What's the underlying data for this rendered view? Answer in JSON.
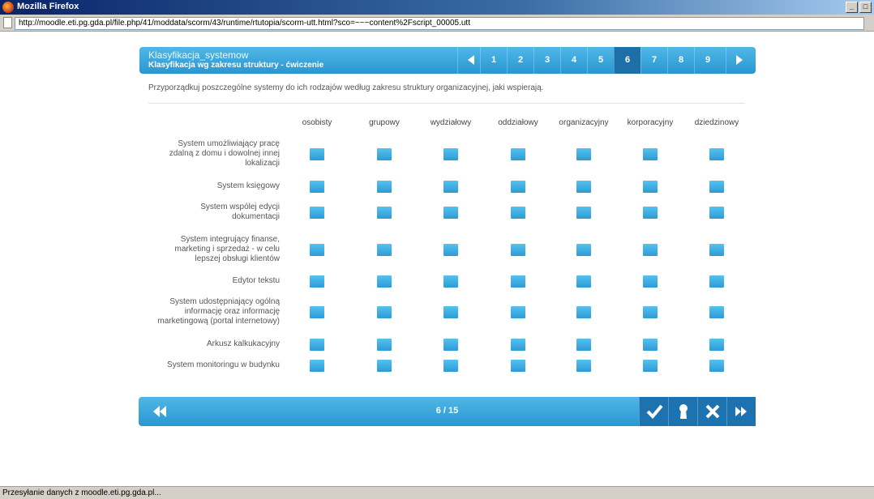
{
  "window": {
    "title": "Mozilla Firefox"
  },
  "address": {
    "url": "http://moodle.eti.pg.gda.pl/file.php/41/moddata/scorm/43/runtime/rtutopia/scorm-utt.html?sco=~~~content%2Fscript_00005.utt"
  },
  "topnav": {
    "course": "Klasyfikacja_systemow",
    "section": "Klasyfikacja wg zakresu struktury - ćwiczenie",
    "pages": [
      "1",
      "2",
      "3",
      "4",
      "5",
      "6",
      "7",
      "8",
      "9"
    ],
    "active_page": "6"
  },
  "instruction": "Przyporządkuj poszczególne systemy do ich rodzajów według zakresu struktury organizacyjnej, jaki wspierają.",
  "matrix": {
    "columns": [
      "osobisty",
      "grupowy",
      "wydziałowy",
      "oddziałowy",
      "organizacyjny",
      "korporacyjny",
      "dziedzinowy"
    ],
    "rows": [
      [
        "System umożliwiający pracę",
        "zdalną z domu i dowolnej innej",
        "lokalizacji"
      ],
      [
        "System księgowy"
      ],
      [
        "System wspólej edycji",
        "dokumentacji"
      ],
      [
        "System integrujący finanse,",
        "marketing i sprzedaż - w celu",
        "lepszej obsługi klientów"
      ],
      [
        "Edytor tekstu"
      ],
      [
        "System udostępniający ogólną",
        "informację oraz informację",
        "marketingową (portal internetowy)"
      ],
      [
        "Arkusz kalkukacyjny"
      ],
      [
        "System monitoringu w budynku"
      ]
    ]
  },
  "bottombar": {
    "counter": "6 / 15"
  },
  "status": {
    "text": "Przesyłanie danych z moodle.eti.pg.gda.pl..."
  }
}
